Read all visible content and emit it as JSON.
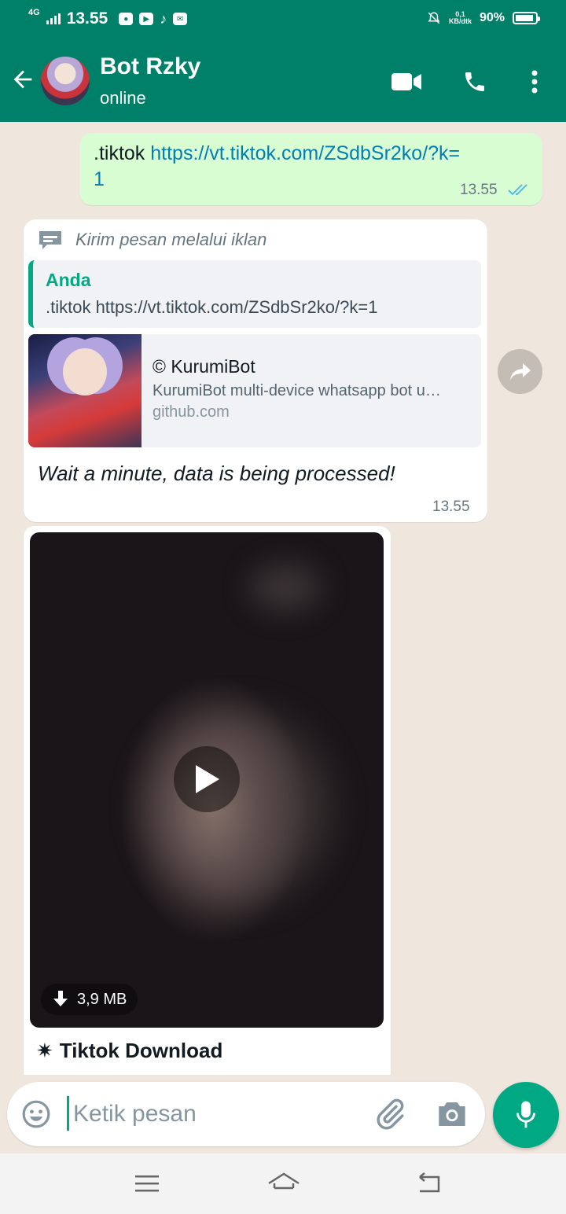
{
  "status_bar": {
    "network": "4G",
    "time": "13.55",
    "data_speed_value": "0,1",
    "data_speed_unit": "KB/dtk",
    "battery": "90%",
    "battery_level": 0.9,
    "app_icons": [
      "game-icon",
      "youtube-icon",
      "tiktok-icon",
      "mail-icon"
    ]
  },
  "header": {
    "title": "Bot Rzky",
    "subtitle": "online",
    "actions": [
      "video-call-icon",
      "voice-call-icon",
      "more-icon"
    ]
  },
  "messages": {
    "sent": {
      "command": ".tiktok",
      "link": "https://vt.tiktok.com/ZSdbSr2ko/?k=",
      "link_wrap": "1",
      "time": "13.55",
      "status": "read"
    },
    "reply": {
      "forwarded_note": "Kirim pesan melalui iklan",
      "quote_author": "Anda",
      "quote_text": ".tiktok https://vt.tiktok.com/ZSdbSr2ko/?k=1",
      "preview_title": "© KurumiBot",
      "preview_desc": "KurumiBot multi-device whatsapp bot u…",
      "preview_domain": "github.com",
      "text": "Wait a minute, data is being processed!",
      "time": "13.55"
    },
    "video": {
      "size": "3,9 MB",
      "caption_icon": "✷",
      "caption": "Tiktok Download"
    }
  },
  "input": {
    "placeholder": "Ketik pesan"
  },
  "colors": {
    "header": "#008069",
    "accent": "#00a884",
    "outgoing_bubble": "#d9fdd3",
    "incoming_bubble": "#ffffff",
    "chat_background": "#efe7de",
    "link": "#027eb5",
    "read_ticks": "#53bdeb"
  }
}
